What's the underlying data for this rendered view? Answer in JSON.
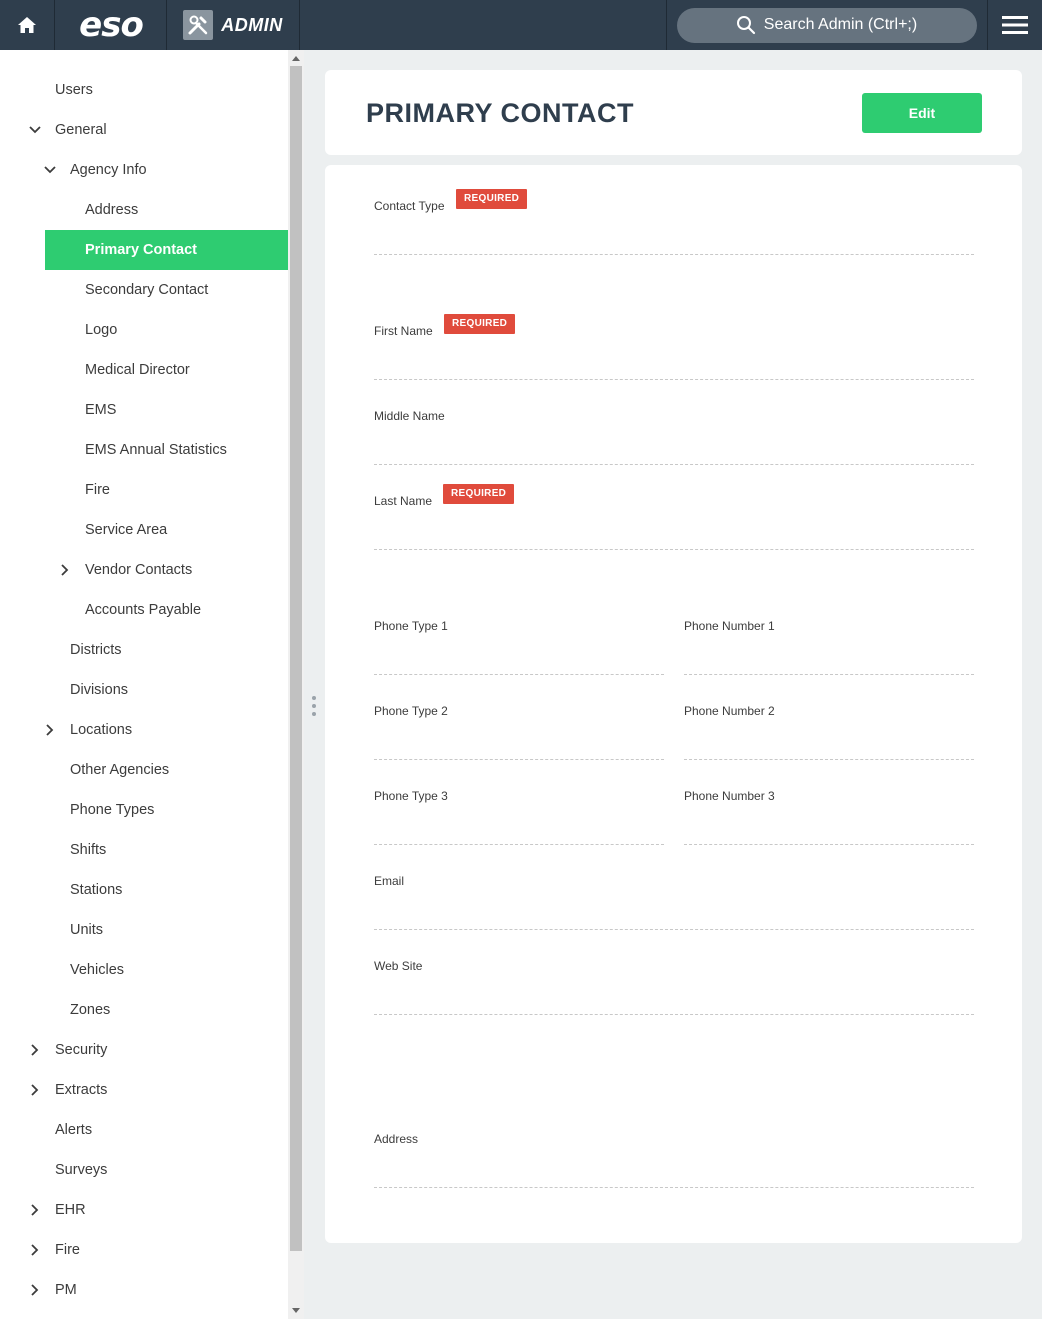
{
  "topbar": {
    "logo_text": "eso",
    "admin_label": "ADMIN",
    "search_placeholder": "Search Admin (Ctrl+;)"
  },
  "sidebar": {
    "items": [
      {
        "label": "Users",
        "chevron": "none"
      },
      {
        "label": "General",
        "chevron": "down"
      },
      {
        "label": "Agency Info",
        "chevron": "down"
      },
      {
        "label": "Address",
        "chevron": "none"
      },
      {
        "label": "Primary Contact",
        "chevron": "none",
        "active": true
      },
      {
        "label": "Secondary Contact",
        "chevron": "none"
      },
      {
        "label": "Logo",
        "chevron": "none"
      },
      {
        "label": "Medical Director",
        "chevron": "none"
      },
      {
        "label": "EMS",
        "chevron": "none"
      },
      {
        "label": "EMS Annual Statistics",
        "chevron": "none"
      },
      {
        "label": "Fire",
        "chevron": "none"
      },
      {
        "label": "Service Area",
        "chevron": "none"
      },
      {
        "label": "Vendor Contacts",
        "chevron": "right"
      },
      {
        "label": "Accounts Payable",
        "chevron": "none"
      },
      {
        "label": "Districts",
        "chevron": "none"
      },
      {
        "label": "Divisions",
        "chevron": "none"
      },
      {
        "label": "Locations",
        "chevron": "right"
      },
      {
        "label": "Other Agencies",
        "chevron": "none"
      },
      {
        "label": "Phone Types",
        "chevron": "none"
      },
      {
        "label": "Shifts",
        "chevron": "none"
      },
      {
        "label": "Stations",
        "chevron": "none"
      },
      {
        "label": "Units",
        "chevron": "none"
      },
      {
        "label": "Vehicles",
        "chevron": "none"
      },
      {
        "label": "Zones",
        "chevron": "none"
      },
      {
        "label": "Security",
        "chevron": "right"
      },
      {
        "label": "Extracts",
        "chevron": "right"
      },
      {
        "label": "Alerts",
        "chevron": "none"
      },
      {
        "label": "Surveys",
        "chevron": "none"
      },
      {
        "label": "EHR",
        "chevron": "right"
      },
      {
        "label": "Fire",
        "chevron": "right"
      },
      {
        "label": "PM",
        "chevron": "right"
      }
    ]
  },
  "main": {
    "title": "PRIMARY CONTACT",
    "edit_label": "Edit",
    "required_label": "REQUIRED",
    "fields": {
      "contact_type": "Contact Type",
      "first_name": "First Name",
      "middle_name": "Middle Name",
      "last_name": "Last Name",
      "phone_type_1": "Phone Type 1",
      "phone_number_1": "Phone Number 1",
      "phone_type_2": "Phone Type 2",
      "phone_number_2": "Phone Number 2",
      "phone_type_3": "Phone Type 3",
      "phone_number_3": "Phone Number 3",
      "email": "Email",
      "web_site": "Web Site",
      "address": "Address"
    }
  },
  "colors": {
    "topbar": "#2f3e4d",
    "accent_green": "#2ecc71",
    "required_red": "#e04b3c"
  }
}
